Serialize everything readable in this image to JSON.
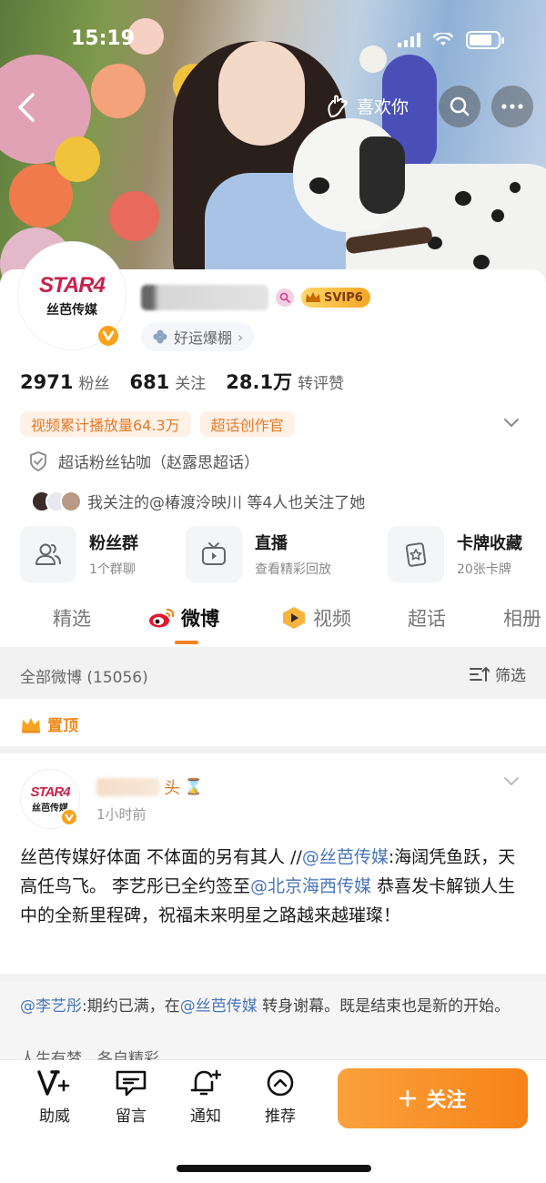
{
  "status_bar": {
    "time": "15:19"
  },
  "header": {
    "like_label": "喜欢你"
  },
  "profile": {
    "avatar_logo_text": "STAR4",
    "avatar_logo_sub": "丝芭传媒",
    "svip_label": "SVIP6",
    "lucky_label": "好运爆棚",
    "stats": [
      {
        "value": "2971",
        "label": "粉丝"
      },
      {
        "value": "681",
        "label": "关注"
      },
      {
        "value": "28.1万",
        "label": "转评赞"
      }
    ],
    "tags": [
      "视频累计播放量64.3万",
      "超话创作官"
    ],
    "superfan_text": "超话粉丝钻咖（赵露思超话）",
    "mutual_follow_text": "我关注的@椿渡泠映川 等4人也关注了她"
  },
  "features": [
    {
      "title": "粉丝群",
      "subtitle": "1个群聊",
      "icon": "people-icon"
    },
    {
      "title": "直播",
      "subtitle": "查看精彩回放",
      "icon": "tv-icon"
    },
    {
      "title": "卡牌收藏",
      "subtitle": "20张卡牌",
      "icon": "card-star-icon"
    }
  ],
  "tabs": [
    {
      "label": "精选",
      "active": false
    },
    {
      "label": "微博",
      "active": true
    },
    {
      "label": "视频",
      "active": false
    },
    {
      "label": "超话",
      "active": false
    },
    {
      "label": "相册",
      "active": false
    }
  ],
  "feed": {
    "all_count_label": "全部微博 (15056)",
    "filter_label": "筛选",
    "pinned_label": "置顶"
  },
  "post": {
    "name_visible": "头",
    "time": "1小时前",
    "body_part1": "丝芭传媒好体面 不体面的另有其人 //",
    "body_link1": "@丝芭传媒",
    "body_part2": ":海阔凭鱼跃，天高任鸟飞。 李艺彤已全约签至",
    "body_link2": "@北京海西传媒",
    "body_part3": " 恭喜发卡解锁人生中的全新里程碑，祝福未来明星之路越来越璀璨！",
    "repost_link1": "@李艺彤",
    "repost_part1": ":期约已满，在",
    "repost_link2": "@丝芭传媒",
    "repost_part2": " 转身谢幕。既是结束也是新的开始。",
    "repost_fade": "人生有梦，各自精彩"
  },
  "bottom_bar": {
    "items": [
      {
        "label": "助威",
        "icon": "v-plus-icon"
      },
      {
        "label": "留言",
        "icon": "message-icon"
      },
      {
        "label": "通知",
        "icon": "bell-plus-icon"
      },
      {
        "label": "推荐",
        "icon": "chevron-up-circle-icon"
      }
    ],
    "follow_label": "关注"
  },
  "colors": {
    "accent": "#f68318",
    "link": "#4a76b8",
    "tag_text": "#e27a2b",
    "brand_pink": "#c8224d"
  }
}
